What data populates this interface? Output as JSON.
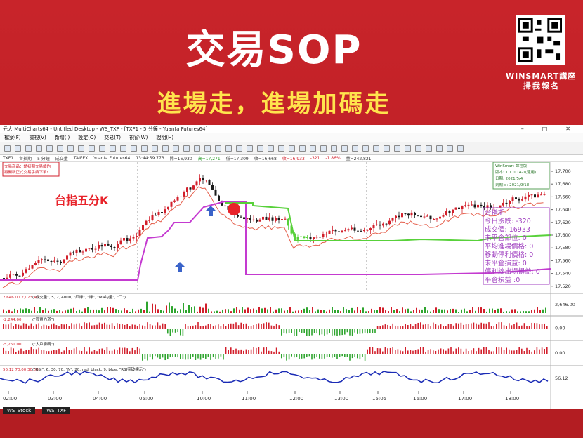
{
  "hero": {
    "title": "交易SOP",
    "subtitle": "進場走，進場加碼走"
  },
  "brand": {
    "name": "WINSMART講座",
    "cta": "掃我報名"
  },
  "window": {
    "title": "元大 MultiCharts64 - Untitled Desktop - WS_TXF - [TXF1 - 5 分鐘 - Yuanta Futures64]"
  },
  "menu": [
    "檔案(F)",
    "檢視(V)",
    "新增(I)",
    "設定(O)",
    "交易(T)",
    "視窗(W)",
    "說明(H)"
  ],
  "symbol_bar": {
    "symbol": "TXF1",
    "name": "台指期",
    "interval": "5 分鐘",
    "vol_label": "成交量",
    "exchange": "TAIFEX",
    "feed": "Yuanta Futures64",
    "time": "13:44:59.773",
    "open": "開=16,930",
    "high": "高=17,271",
    "low": "低=17,309",
    "close": "收=16,668",
    "bid": "收=16,933",
    "chg": "-321",
    "pct": "-1.86%",
    "vol": "量=242,821"
  },
  "warning": [
    "交易商品：請初期交易續約",
    "再開新正式交易手續下單!"
  ],
  "info_box": [
    "WinSmart 課程版",
    "版本: 1.1.0 14-1(適用)",
    "日期: 2021/5/4",
    "到期日: 2021/9/18"
  ],
  "chart_label": "台指五分K",
  "stats": [
    "台指期",
    "今日漲跌: -320",
    "成交價: 16933",
    "未平倉部位: 0",
    "平均進場價格: 0",
    "移動停利價格: 0",
    "未平倉損益: 0",
    "停利線出場損益: 0",
    "平倉損益 :0"
  ],
  "y_ticks": [
    "17,700",
    "17,680",
    "17,660",
    "17,640",
    "17,620",
    "17,600",
    "17,580",
    "17,560",
    "17,540",
    "17,520"
  ],
  "x_ticks": [
    "02:00",
    "03:00",
    "04:00",
    "05:00",
    "10:00",
    "11:00",
    "12:00",
    "13:00",
    "15:05",
    "16:00",
    "17:00",
    "18:00"
  ],
  "sub_panels": [
    {
      "label": "(\"成交量\", 5, 2, 4000, \"紅綠\", \"綠\", \"MA均量\", \"口\")",
      "value": "2,646.00",
      "left": "2,646.00  2,073.40"
    },
    {
      "label": "(\"買賣力道\")",
      "value": "0.00",
      "left": "-2,244.00"
    },
    {
      "label": "(\"大戶籌碼\")",
      "value": "0.00",
      "left": "-5,261.00"
    },
    {
      "label": "(\"RSI\", 6, 30, 70, \"N\", 20, red, black, 9, blue, \"RSI突破標示\")",
      "value": "56.12",
      "left": "56.12  70.00  30.00"
    }
  ],
  "tabs": [
    "WS_Stock",
    "WS_TXF"
  ],
  "colors": {
    "bg": "#c41e24",
    "accent": "#ffe44d",
    "up": "#d21f2b",
    "down": "#1a1a1a",
    "trail": "#58d13a",
    "avg": "#c43ad0",
    "ma": "#e55f4c"
  }
}
